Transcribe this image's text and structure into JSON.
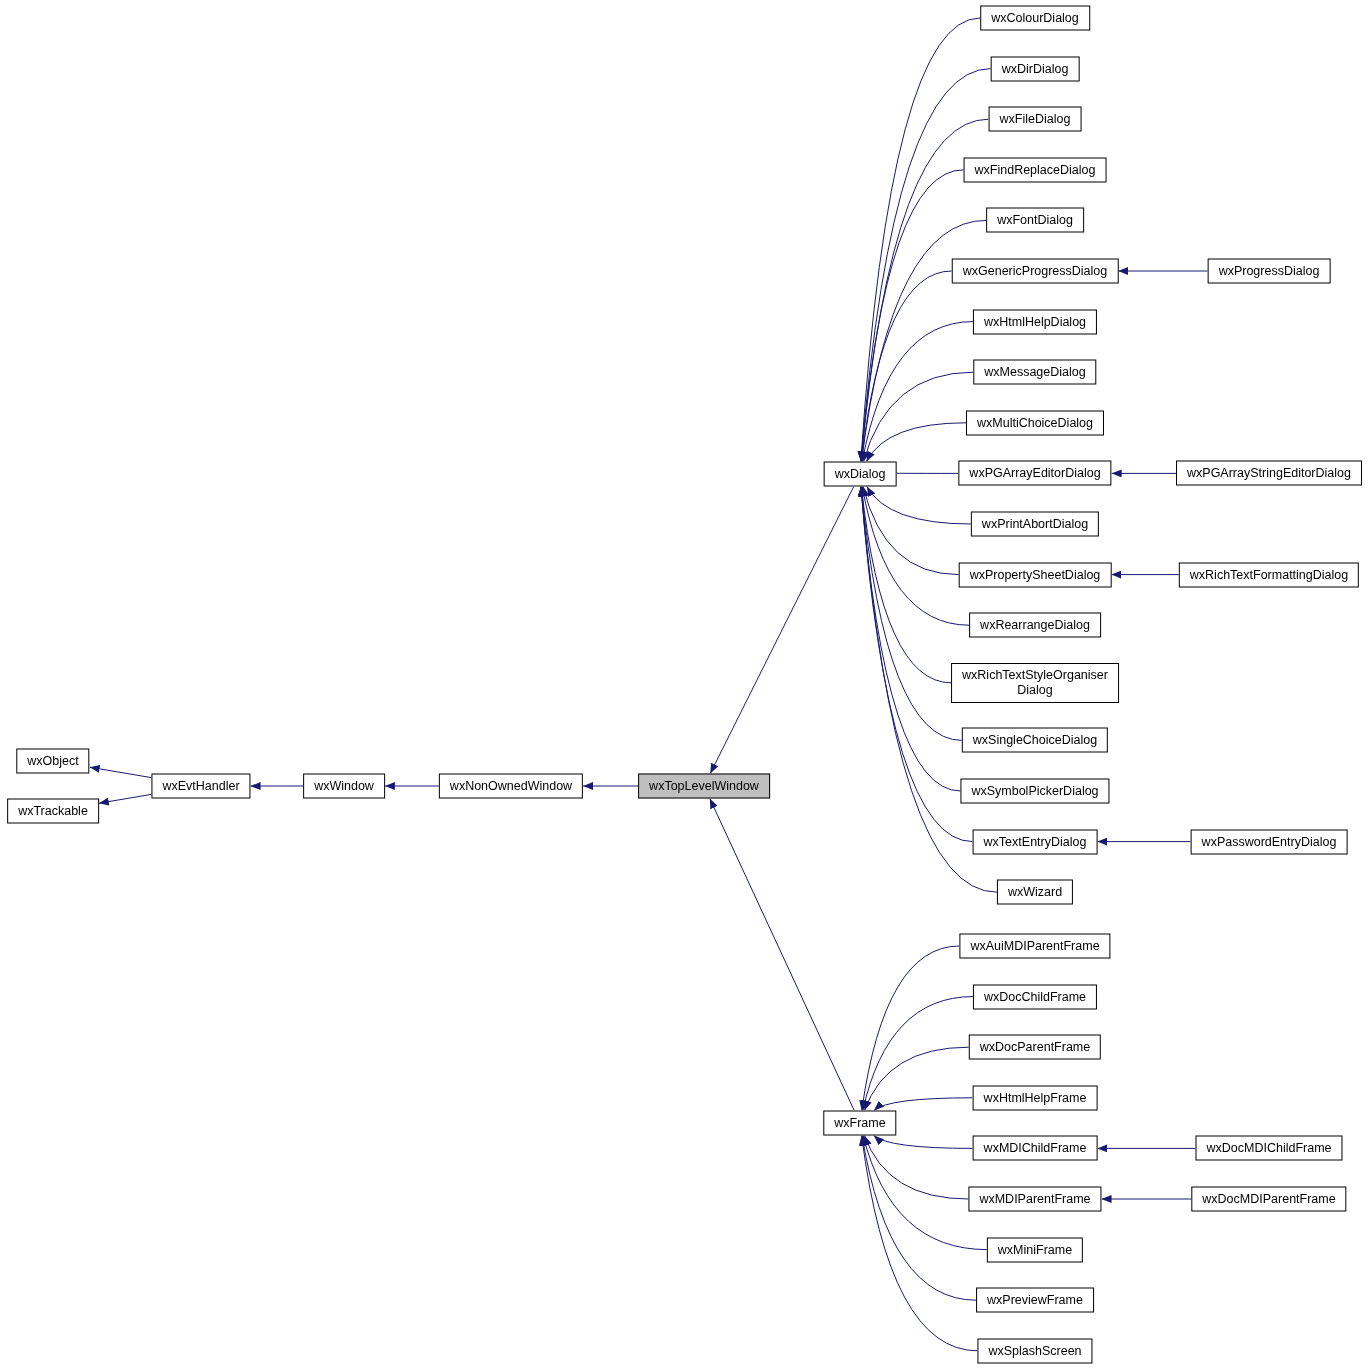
{
  "graph": {
    "focus": {
      "label": "wxTopLevelWindow",
      "selected": true
    },
    "bases": [
      {
        "label": "wxNonOwnedWindow",
        "selected": false,
        "bases": [
          {
            "label": "wxWindow",
            "selected": false,
            "bases": [
              {
                "label": "wxEvtHandler",
                "selected": false,
                "bases": [
                  {
                    "label": "wxObject",
                    "selected": false
                  },
                  {
                    "label": "wxTrackable",
                    "selected": false
                  }
                ]
              }
            ]
          }
        ]
      }
    ],
    "children": [
      {
        "label": "wxDialog",
        "selected": false,
        "children": [
          {
            "label": "wxColourDialog",
            "selected": false
          },
          {
            "label": "wxDirDialog",
            "selected": false
          },
          {
            "label": "wxFileDialog",
            "selected": false
          },
          {
            "label": "wxFindReplaceDialog",
            "selected": false
          },
          {
            "label": "wxFontDialog",
            "selected": false
          },
          {
            "label": "wxGenericProgressDialog",
            "selected": false,
            "children": [
              {
                "label": "wxProgressDialog",
                "selected": false
              }
            ]
          },
          {
            "label": "wxHtmlHelpDialog",
            "selected": false
          },
          {
            "label": "wxMessageDialog",
            "selected": false
          },
          {
            "label": "wxMultiChoiceDialog",
            "selected": false
          },
          {
            "label": "wxPGArrayEditorDialog",
            "selected": false,
            "children": [
              {
                "label": "wxPGArrayStringEditorDialog",
                "selected": false
              }
            ]
          },
          {
            "label": "wxPrintAbortDialog",
            "selected": false
          },
          {
            "label": "wxPropertySheetDialog",
            "selected": false,
            "children": [
              {
                "label": "wxRichTextFormattingDialog",
                "selected": false
              }
            ]
          },
          {
            "label": "wxRearrangeDialog",
            "selected": false
          },
          {
            "label": "wxRichTextStyleOrganiser\nDialog",
            "selected": false
          },
          {
            "label": "wxSingleChoiceDialog",
            "selected": false
          },
          {
            "label": "wxSymbolPickerDialog",
            "selected": false
          },
          {
            "label": "wxTextEntryDialog",
            "selected": false,
            "children": [
              {
                "label": "wxPasswordEntryDialog",
                "selected": false
              }
            ]
          },
          {
            "label": "wxWizard",
            "selected": false
          }
        ]
      },
      {
        "label": "wxFrame",
        "selected": false,
        "children": [
          {
            "label": "wxAuiMDIParentFrame",
            "selected": false
          },
          {
            "label": "wxDocChildFrame",
            "selected": false
          },
          {
            "label": "wxDocParentFrame",
            "selected": false
          },
          {
            "label": "wxHtmlHelpFrame",
            "selected": false
          },
          {
            "label": "wxMDIChildFrame",
            "selected": false,
            "children": [
              {
                "label": "wxDocMDIChildFrame",
                "selected": false
              }
            ]
          },
          {
            "label": "wxMDIParentFrame",
            "selected": false,
            "children": [
              {
                "label": "wxDocMDIParentFrame",
                "selected": false
              }
            ]
          },
          {
            "label": "wxMiniFrame",
            "selected": false
          },
          {
            "label": "wxPreviewFrame",
            "selected": false
          },
          {
            "label": "wxSplashScreen",
            "selected": false
          }
        ]
      }
    ]
  }
}
